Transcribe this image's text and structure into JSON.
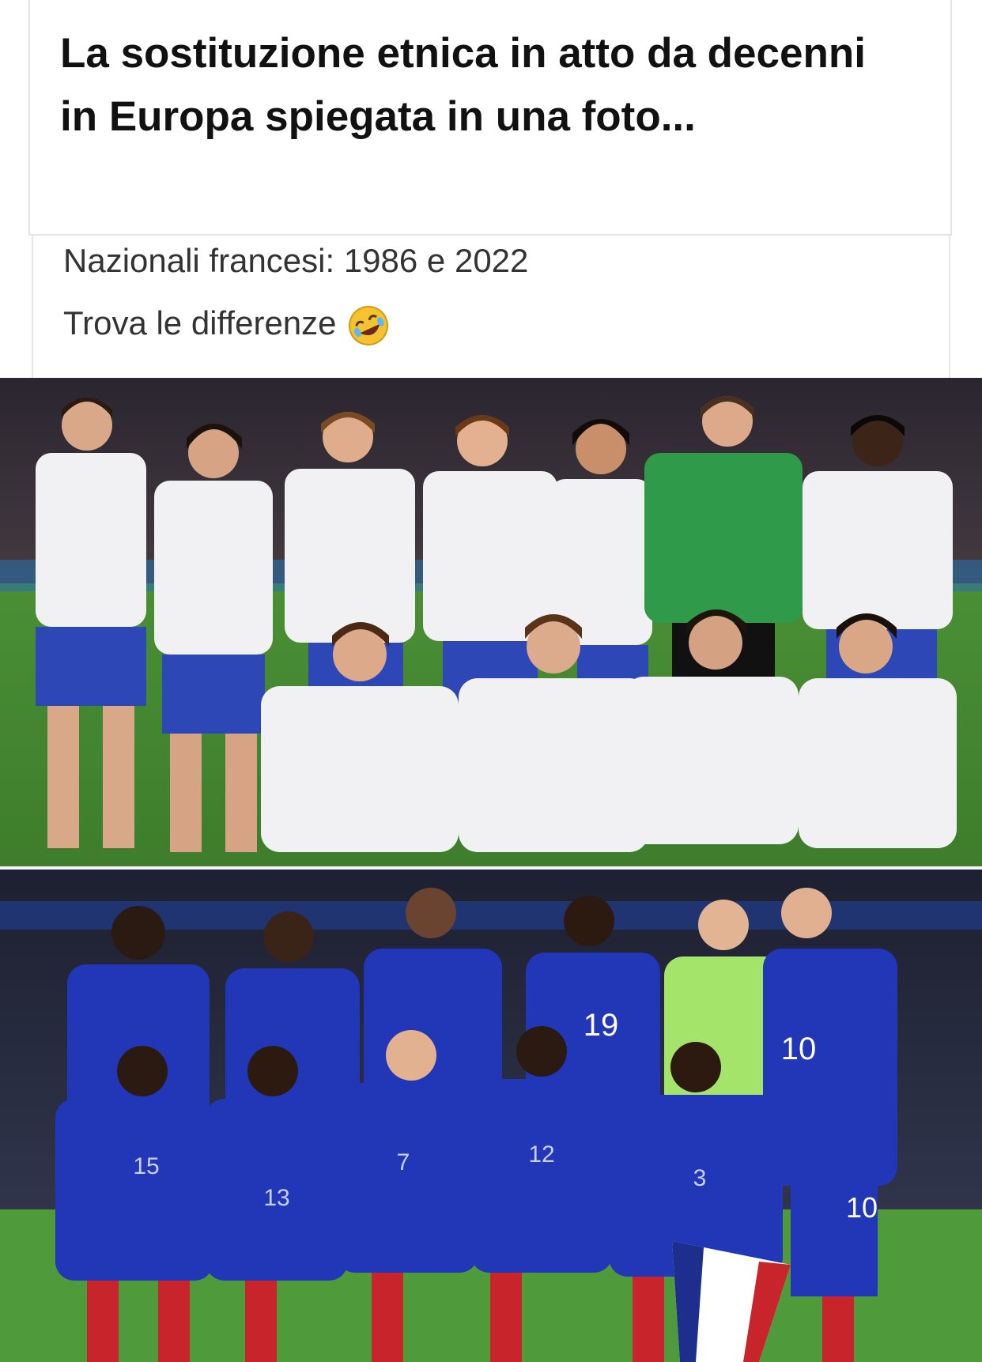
{
  "post": {
    "title": "La sostituzione etnica in atto da decenni in Europa spiegata in una foto...",
    "subtitle_line1": "Nazionali francesi: 1986 e 2022",
    "subtitle_line2": "Trova le differenze",
    "emoji": "rolling-on-floor-laughing-emoji"
  },
  "photos": [
    {
      "name": "1986-team-photo",
      "players_standing": 7,
      "players_kneeling": 4,
      "colors": {
        "shirt": "#f1f1f4",
        "shorts": "#2d48b6",
        "keeper": "#2f9a4a",
        "pitch": "#4f9a3a"
      }
    },
    {
      "name": "2022-team-photo",
      "jersey_numbers_visible": [
        "19",
        "10",
        "15",
        "13",
        "7",
        "12",
        "3",
        "10"
      ],
      "colors": {
        "shirt": "#2236b8",
        "keeper": "#a5e46a",
        "socks": "#c8242c",
        "pitch": "#4f9a3a"
      }
    }
  ]
}
